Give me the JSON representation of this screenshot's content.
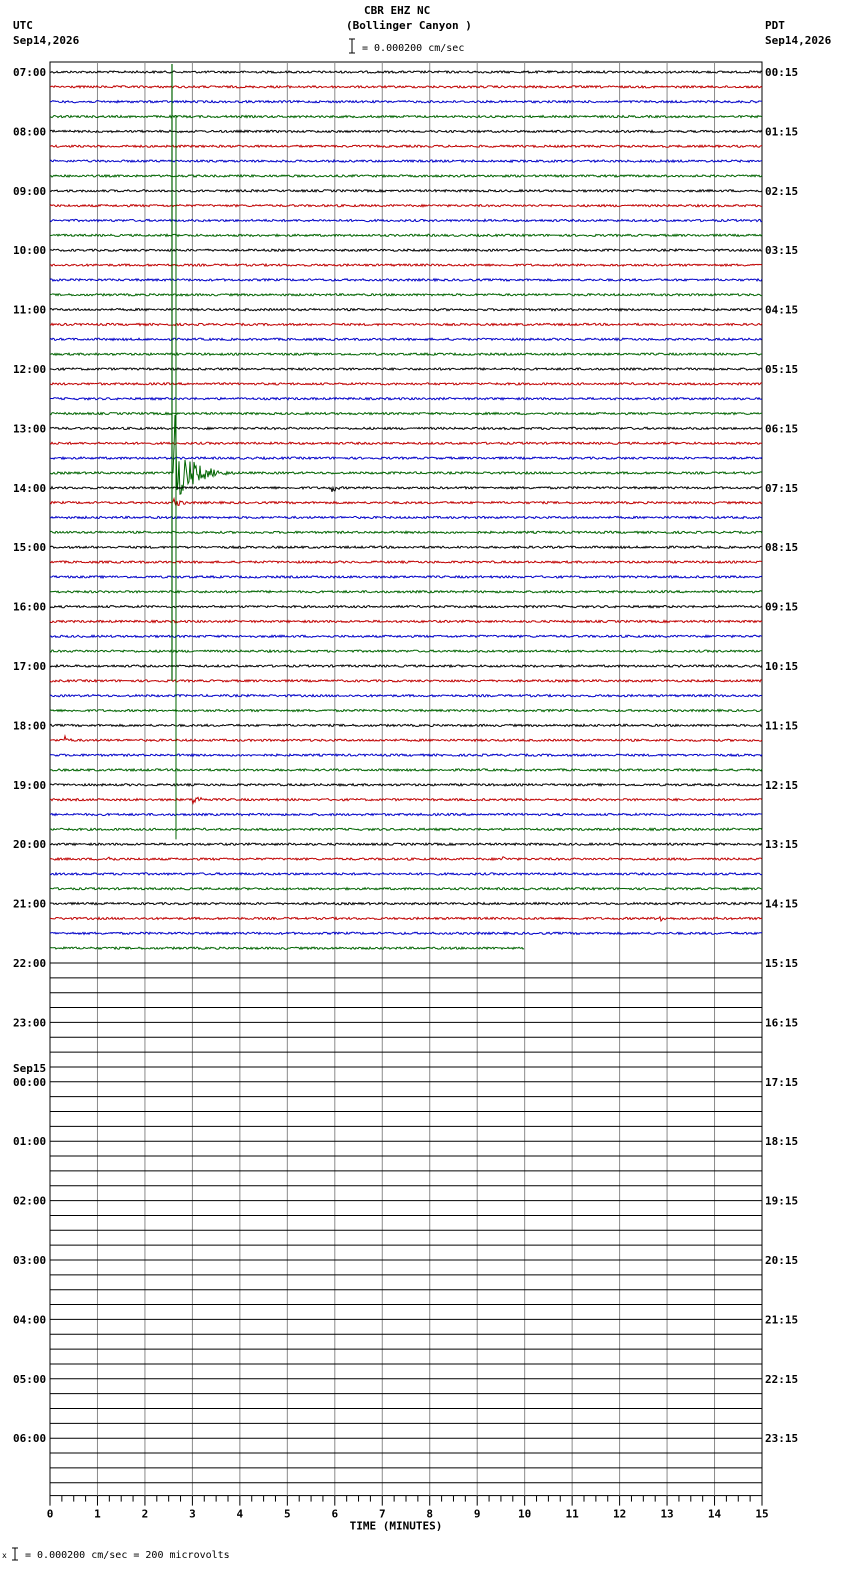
{
  "header": {
    "station": "CBR EHZ NC",
    "location": "(Bollinger Canyon )",
    "scale_label": "= 0.000200 cm/sec",
    "left_zone": "UTC",
    "left_date": "Sep14,2026",
    "right_zone": "PDT",
    "right_date": "Sep14,2026"
  },
  "footer": {
    "calibration": "= 0.000200 cm/sec =     200 microvolts"
  },
  "chart_data": {
    "type": "line",
    "xlabel": "TIME (MINUTES)",
    "xlim": [
      0,
      15
    ],
    "x_ticks": [
      "0",
      "1",
      "2",
      "3",
      "4",
      "5",
      "6",
      "7",
      "8",
      "9",
      "10",
      "11",
      "12",
      "13",
      "14",
      "15"
    ],
    "trace_colors": [
      "#000000",
      "#c00000",
      "#0000c8",
      "#006400"
    ],
    "traces_per_hour": 4,
    "total_rows": 96,
    "filled_rows": 60,
    "last_row_end_minute": 10,
    "utc_labels": [
      {
        "row": 0,
        "text": "07:00"
      },
      {
        "row": 4,
        "text": "08:00"
      },
      {
        "row": 8,
        "text": "09:00"
      },
      {
        "row": 12,
        "text": "10:00"
      },
      {
        "row": 16,
        "text": "11:00"
      },
      {
        "row": 20,
        "text": "12:00"
      },
      {
        "row": 24,
        "text": "13:00"
      },
      {
        "row": 28,
        "text": "14:00"
      },
      {
        "row": 32,
        "text": "15:00"
      },
      {
        "row": 36,
        "text": "16:00"
      },
      {
        "row": 40,
        "text": "17:00"
      },
      {
        "row": 44,
        "text": "18:00"
      },
      {
        "row": 48,
        "text": "19:00"
      },
      {
        "row": 52,
        "text": "20:00"
      },
      {
        "row": 56,
        "text": "21:00"
      },
      {
        "row": 60,
        "text": "22:00"
      },
      {
        "row": 64,
        "text": "23:00"
      },
      {
        "row": 68,
        "text": "00:00",
        "date": "Sep15"
      },
      {
        "row": 72,
        "text": "01:00"
      },
      {
        "row": 76,
        "text": "02:00"
      },
      {
        "row": 80,
        "text": "03:00"
      },
      {
        "row": 84,
        "text": "04:00"
      },
      {
        "row": 88,
        "text": "05:00"
      },
      {
        "row": 92,
        "text": "06:00"
      }
    ],
    "pdt_labels": [
      {
        "row": 0,
        "text": "00:15"
      },
      {
        "row": 4,
        "text": "01:15"
      },
      {
        "row": 8,
        "text": "02:15"
      },
      {
        "row": 12,
        "text": "03:15"
      },
      {
        "row": 16,
        "text": "04:15"
      },
      {
        "row": 20,
        "text": "05:15"
      },
      {
        "row": 24,
        "text": "06:15"
      },
      {
        "row": 28,
        "text": "07:15"
      },
      {
        "row": 32,
        "text": "08:15"
      },
      {
        "row": 36,
        "text": "09:15"
      },
      {
        "row": 40,
        "text": "10:15"
      },
      {
        "row": 44,
        "text": "11:15"
      },
      {
        "row": 48,
        "text": "12:15"
      },
      {
        "row": 52,
        "text": "13:15"
      },
      {
        "row": 56,
        "text": "14:15"
      },
      {
        "row": 60,
        "text": "15:15"
      },
      {
        "row": 64,
        "text": "16:15"
      },
      {
        "row": 68,
        "text": "17:15"
      },
      {
        "row": 72,
        "text": "18:15"
      },
      {
        "row": 76,
        "text": "19:15"
      },
      {
        "row": 80,
        "text": "20:15"
      },
      {
        "row": 84,
        "text": "21:15"
      },
      {
        "row": 88,
        "text": "22:15"
      },
      {
        "row": 92,
        "text": "23:15"
      }
    ],
    "events": [
      {
        "row": 27,
        "minute": 2.6,
        "duration": 1.6,
        "amplitude": "very large",
        "note": "main earthquake"
      },
      {
        "row": 28,
        "minute": 5.9,
        "duration": 0.4,
        "amplitude": "medium"
      },
      {
        "row": 29,
        "minute": 2.6,
        "duration": 0.9,
        "amplitude": "small"
      },
      {
        "row": 45,
        "minute": 0.3,
        "duration": 0.5,
        "amplitude": "small"
      },
      {
        "row": 49,
        "minute": 3.0,
        "duration": 1.0,
        "amplitude": "small"
      },
      {
        "row": 53,
        "minute": 1.2,
        "duration": 0.6,
        "amplitude": "small"
      },
      {
        "row": 53,
        "minute": 9.5,
        "duration": 0.4,
        "amplitude": "small"
      },
      {
        "row": 57,
        "minute": 12.8,
        "duration": 0.8,
        "amplitude": "small"
      }
    ]
  }
}
